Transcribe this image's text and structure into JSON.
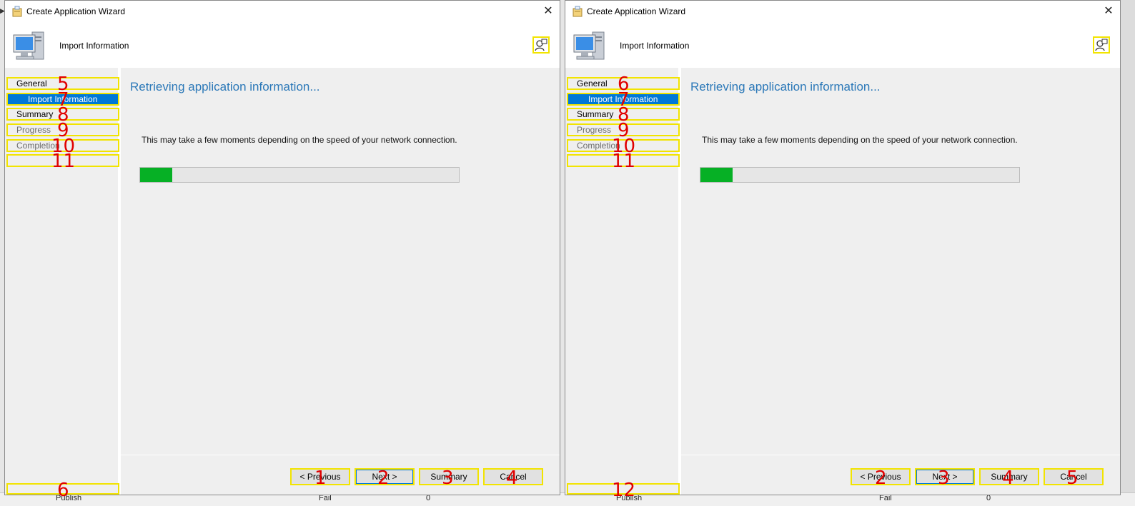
{
  "wizards": [
    {
      "title": "Create Application Wizard",
      "header": "Import Information",
      "steps": [
        "General",
        "Import Information",
        "Summary",
        "Progress",
        "Completion"
      ],
      "content_title": "Retrieving application information...",
      "message": "This may take a few moments depending on the speed of your network connection.",
      "progress_fraction": 0.1,
      "buttons": {
        "previous": "< Previous",
        "next": "Next >",
        "summary": "Summary",
        "cancel": "Cancel"
      },
      "markers": {
        "previous": "1",
        "next": "2",
        "summary": "3",
        "cancel": "4",
        "general": "5",
        "bottom": "6",
        "import": "7",
        "summary_step": "8",
        "progress": "9",
        "completion": "10",
        "blank": "11"
      }
    },
    {
      "title": "Create Application Wizard",
      "header": "Import Information",
      "steps": [
        "General",
        "Import Information",
        "Summary",
        "Progress",
        "Completion"
      ],
      "content_title": "Retrieving application information...",
      "message": "This may take a few moments depending on the speed of your network connection.",
      "progress_fraction": 0.1,
      "buttons": {
        "previous": "< Previous",
        "next": "Next >",
        "summary": "Summary",
        "cancel": "Cancel"
      },
      "markers": {
        "previous": "2",
        "next": "3",
        "summary": "4",
        "cancel": "5",
        "general": "6",
        "bottom": "12",
        "import": "7",
        "summary_step": "8",
        "progress": "9",
        "completion": "10",
        "blank": "11"
      }
    }
  ],
  "background_fragments": [
    "Publish",
    "Fail",
    "0"
  ],
  "colors": {
    "accent": "#0078d7",
    "progress": "#06b025",
    "title_blue": "#2b78b8",
    "highlight": "#f2e400",
    "marker": "#e00000"
  }
}
